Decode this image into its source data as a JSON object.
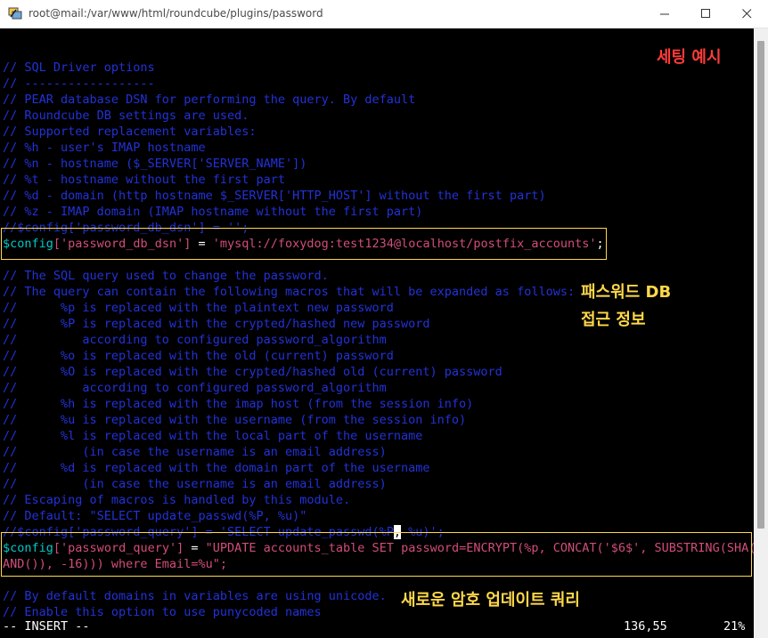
{
  "window": {
    "title": "root@mail:/var/www/html/roundcube/plugins/password",
    "icon": "putty-terminal-icon"
  },
  "editor": {
    "comments_top": [
      "// SQL Driver options",
      "// ------------------",
      "// PEAR database DSN for performing the query. By default",
      "// Roundcube DB settings are used.",
      "// Supported replacement variables:",
      "// %h - user's IMAP hostname",
      "// %n - hostname ($_SERVER['SERVER_NAME'])",
      "// %t - hostname without the first part",
      "// %d - domain (http hostname $_SERVER['HTTP_HOST'] without the first part)",
      "// %z - IMAP domain (IMAP hostname without the first part)",
      "//$config['password_db_dsn'] = '';"
    ],
    "dsn_line": {
      "var": "$config",
      "lb": "[",
      "key": "'password_db_dsn'",
      "rb": "]",
      "eq": " = ",
      "value": "'mysql://foxydog:test1234@localhost/postfix_accounts'",
      "end": ";"
    },
    "blank_1": "",
    "comments_mid": [
      "// The SQL query used to change the password.",
      "// The query can contain the following macros that will be expanded as follows:",
      "//      %p is replaced with the plaintext new password",
      "//      %P is replaced with the crypted/hashed new password",
      "//         according to configured password_algorithm",
      "//      %o is replaced with the old (current) password",
      "//      %O is replaced with the crypted/hashed old (current) password",
      "//         according to configured password_algorithm",
      "//      %h is replaced with the imap host (from the session info)",
      "//      %u is replaced with the username (from the session info)",
      "//      %l is replaced with the local part of the username",
      "//         (in case the username is an email address)",
      "//      %d is replaced with the domain part of the username",
      "//         (in case the username is an email address)",
      "// Escaping of macros is handled by this module.",
      "// Default: \"SELECT update_passwd(%P, %u)\""
    ],
    "commented_query_a": "//$config['password_query'] = 'SELECT update_passwd(%P",
    "commented_query_cursor_char": ",",
    "commented_query_b": " %u)';",
    "query_line_1": {
      "var": "$config",
      "lb": "[",
      "key": "'password_query'",
      "rb": "]",
      "eq": " = ",
      "value": "\"UPDATE accounts_table SET password=ENCRYPT(%p, CONCAT('$6$', SUBSTRING(SHA(R"
    },
    "query_line_2": "AND()), -16))) where Email=%u\";",
    "blank_2": "",
    "comments_bottom": [
      "// By default domains in variables are using unicode.",
      "// Enable this option to use punycoded names"
    ]
  },
  "annotations": {
    "example": "세팅 예시",
    "db_info_1": "패스워드 DB",
    "db_info_2": "접근 정보",
    "new_query": "새로운 암호 업데이트 쿼리"
  },
  "statusbar": {
    "mode": "-- INSERT --",
    "position": "136,55",
    "percent": "21%"
  },
  "colors": {
    "comment": "#2232d8",
    "variable": "#00c8c8",
    "string": "#d24d7a",
    "highlight_box": "#ffd84a",
    "annotation_red": "#ff3b3b",
    "annotation_yellow": "#ffd84a"
  }
}
